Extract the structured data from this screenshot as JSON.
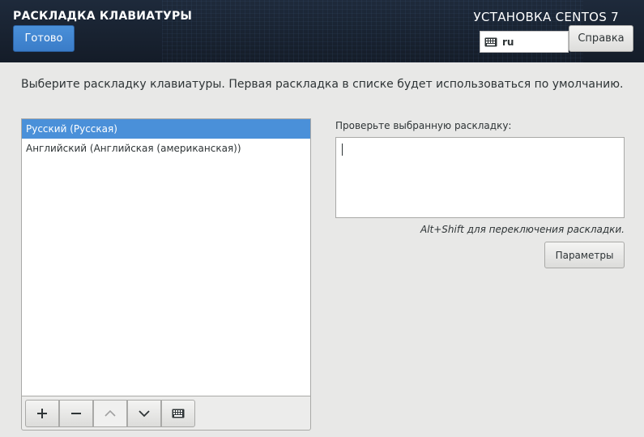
{
  "header": {
    "title": "РАСКЛАДКА КЛАВИАТУРЫ",
    "done_label": "Готово",
    "product_title": "УСТАНОВКА CENTOS 7",
    "layout_code": "ru",
    "help_label": "Справка"
  },
  "main": {
    "instructions": "Выберите раскладку клавиатуры. Первая раскладка в списке будет использоваться по умолчанию."
  },
  "layouts": {
    "items": [
      {
        "label": "Русский (Русская)",
        "selected": true
      },
      {
        "label": "Английский (Английская (американская))",
        "selected": false
      }
    ]
  },
  "toolbar": {
    "buttons": [
      {
        "name": "add-layout-button",
        "icon": "plus-icon",
        "glyph": "+",
        "enabled": true
      },
      {
        "name": "remove-layout-button",
        "icon": "minus-icon",
        "glyph": "−",
        "enabled": true
      },
      {
        "name": "move-up-button",
        "icon": "chevron-up-icon",
        "glyph": "",
        "enabled": false
      },
      {
        "name": "move-down-button",
        "icon": "chevron-down-icon",
        "glyph": "",
        "enabled": true
      },
      {
        "name": "preview-layout-button",
        "icon": "keyboard-icon",
        "glyph": "",
        "enabled": true
      }
    ]
  },
  "test": {
    "label": "Проверьте выбранную раскладку:",
    "value": "",
    "switch_hint": "Alt+Shift для переключения раскладки.",
    "options_label": "Параметры"
  },
  "colors": {
    "header_bg": "#1e2a3b",
    "accent": "#4a90d9",
    "page_bg": "#e8e8e7"
  }
}
